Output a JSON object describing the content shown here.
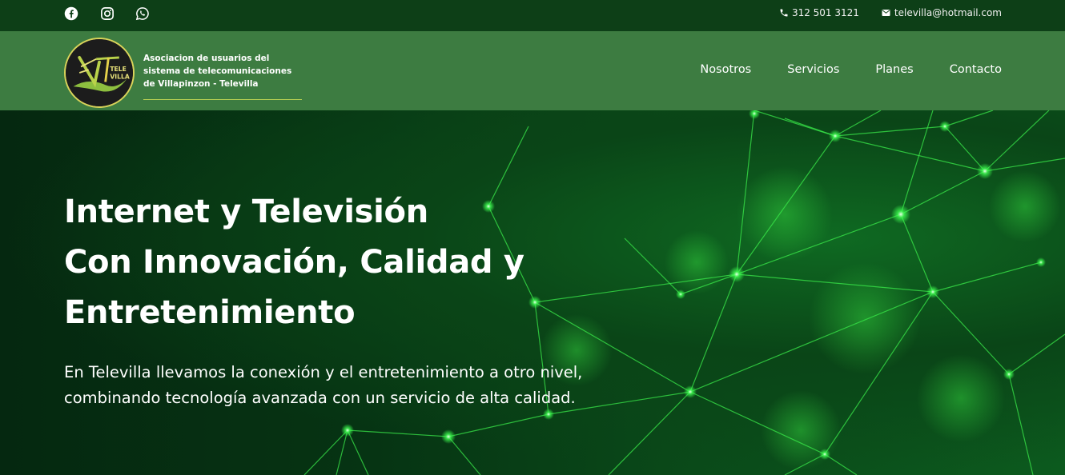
{
  "topbar": {
    "social": [
      {
        "icon": "facebook-icon"
      },
      {
        "icon": "instagram-icon"
      },
      {
        "icon": "whatsapp-icon"
      }
    ],
    "phone": "312 501 3121",
    "email": "televilla@hotmail.com"
  },
  "header": {
    "logo_text": "TELE VILLA",
    "org_name": "Asociacion de usuarios del sistema de telecomunicaciones de Villapinzon - Televilla",
    "nav": [
      {
        "label": "Nosotros"
      },
      {
        "label": "Servicios"
      },
      {
        "label": "Planes"
      },
      {
        "label": "Contacto"
      }
    ]
  },
  "hero": {
    "headline": [
      "Internet y Televisión",
      "Con Innovación, Calidad y",
      "Entretenimiento"
    ],
    "lead": "En Televilla llevamos la conexión y el entretenimiento a otro nivel, combinando tecnología avanzada con un servicio de alta calidad."
  },
  "colors": {
    "topbar_bg": "#0d3f17",
    "header_bg": "#3d7c41",
    "hero_bg": "#063413",
    "accent_line": "#b6cf52",
    "network_glow": "#3dff4f"
  }
}
